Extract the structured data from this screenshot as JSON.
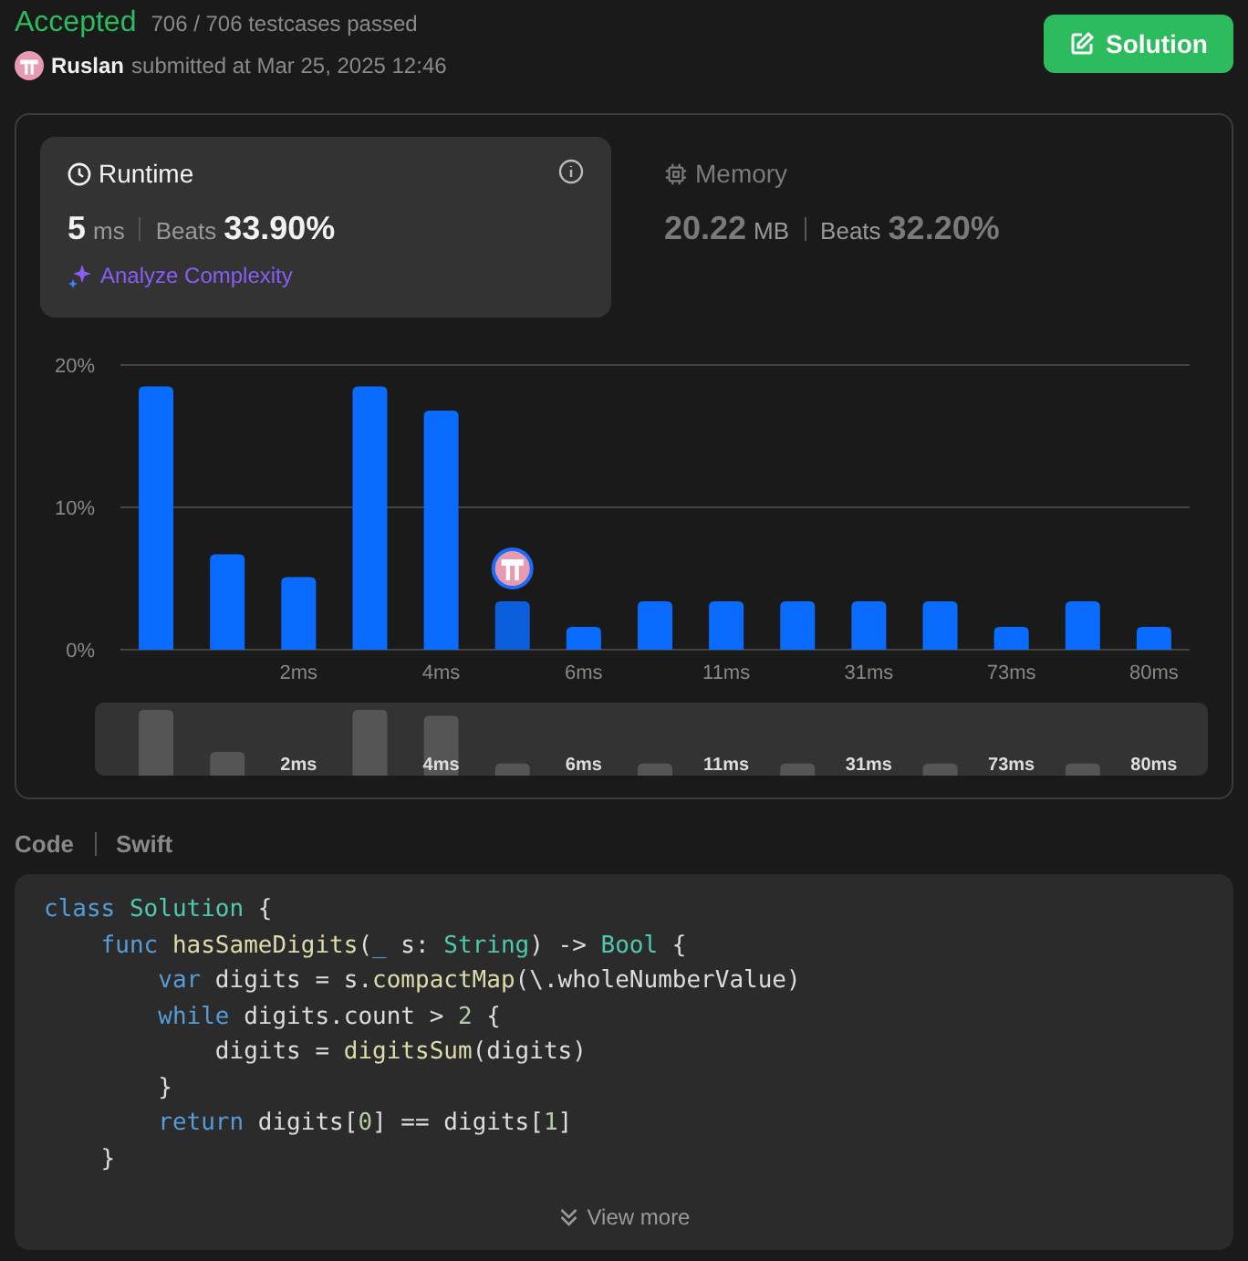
{
  "header": {
    "status": "Accepted",
    "testcases": "706 / 706 testcases passed",
    "user": "Ruslan",
    "submitted": "submitted at Mar 25, 2025 12:46",
    "solution_button": "Solution"
  },
  "metrics": [
    {
      "kind": "runtime",
      "label": "Runtime",
      "value": "5",
      "unit": "ms",
      "beats_label": "Beats",
      "beats": "33.90%",
      "selected": true,
      "link": "Analyze Complexity"
    },
    {
      "kind": "memory",
      "label": "Memory",
      "value": "20.22",
      "unit": "MB",
      "beats_label": "Beats",
      "beats": "32.20%",
      "selected": false
    }
  ],
  "chart": {
    "chart_data": {
      "type": "bar",
      "values": [
        18.5,
        6.7,
        5.1,
        18.5,
        16.8,
        3.4,
        1.6,
        3.4,
        3.4,
        3.4,
        3.4,
        3.4,
        1.6,
        3.4,
        1.6
      ],
      "categories": [
        null,
        null,
        "2ms",
        null,
        "4ms",
        null,
        "6ms",
        null,
        "11ms",
        null,
        "31ms",
        null,
        "73ms",
        null,
        "80ms"
      ],
      "ylim": [
        0,
        20
      ],
      "yticks": [
        {
          "value": 0,
          "label": "0%"
        },
        {
          "value": 10,
          "label": "10%"
        },
        {
          "value": 20,
          "label": "20%"
        }
      ]
    },
    "overview_labels": [
      "2ms",
      "4ms",
      "6ms",
      "11ms",
      "31ms",
      "73ms",
      "80ms"
    ]
  },
  "code": {
    "title": "Code",
    "language": "Swift",
    "view_more": "View more",
    "lines": [
      [
        {
          "t": "class ",
          "kind": "kw"
        },
        {
          "t": "Solution",
          "kind": "type"
        },
        {
          "t": " {",
          "kind": "plain"
        }
      ],
      [
        {
          "t": "    func ",
          "kind": "kw"
        },
        {
          "t": "hasSameDigits",
          "kind": "fn"
        },
        {
          "t": "(",
          "kind": "plain"
        },
        {
          "t": "_",
          "kind": "kw"
        },
        {
          "t": " s: ",
          "kind": "plain"
        },
        {
          "t": "String",
          "kind": "type"
        },
        {
          "t": ") -> ",
          "kind": "plain"
        },
        {
          "t": "Bool",
          "kind": "type"
        },
        {
          "t": " {",
          "kind": "plain"
        }
      ],
      [
        {
          "t": "        var ",
          "kind": "kw"
        },
        {
          "t": "digits = s.",
          "kind": "plain"
        },
        {
          "t": "compactMap",
          "kind": "fn"
        },
        {
          "t": "(\\.wholeNumberValue)",
          "kind": "plain"
        }
      ],
      [
        {
          "t": "        while ",
          "kind": "kw"
        },
        {
          "t": "digits.count > ",
          "kind": "plain"
        },
        {
          "t": "2",
          "kind": "num"
        },
        {
          "t": " {",
          "kind": "plain"
        }
      ],
      [
        {
          "t": "            digits = ",
          "kind": "plain"
        },
        {
          "t": "digitsSum",
          "kind": "fn"
        },
        {
          "t": "(digits)",
          "kind": "plain"
        }
      ],
      [
        {
          "t": "        }",
          "kind": "plain"
        }
      ],
      [
        {
          "t": "        return ",
          "kind": "kw"
        },
        {
          "t": "digits[",
          "kind": "plain"
        },
        {
          "t": "0",
          "kind": "num"
        },
        {
          "t": "] == digits[",
          "kind": "plain"
        },
        {
          "t": "1",
          "kind": "num"
        },
        {
          "t": "]",
          "kind": "plain"
        }
      ],
      [
        {
          "t": "    }",
          "kind": "plain"
        }
      ]
    ]
  }
}
